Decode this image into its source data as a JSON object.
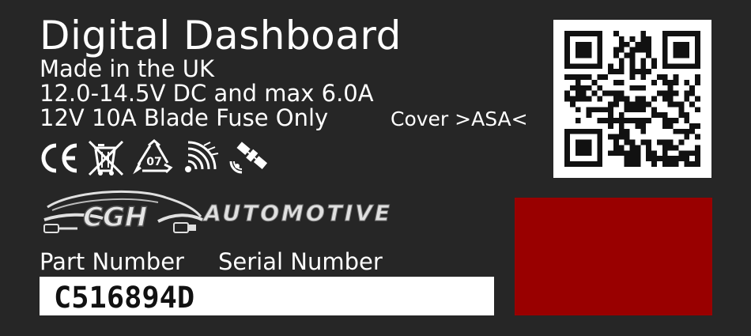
{
  "label": {
    "title": "Digital Dashboard",
    "origin": "Made in the UK",
    "power": "12.0-14.5V DC and max 6.0A",
    "fuse": "12V 10A Blade Fuse Only",
    "cover": "Cover >ASA<"
  },
  "icons": [
    "ce-mark-icon",
    "weee-bin-icon",
    "recycle-07-icon",
    "wireless-icon",
    "satellite-icon"
  ],
  "recycle_code": "07",
  "logo": {
    "brand": "CGH",
    "suffix": "AUTOMOTIVE"
  },
  "fields": {
    "part_number_label": "Part Number",
    "serial_number_label": "Serial Number",
    "part_number_value": "C516894D"
  },
  "colors": {
    "background": "#262626",
    "text": "#ffffff",
    "red_panel": "#990000",
    "qr_fg": "#111111",
    "qr_bg": "#ffffff"
  }
}
